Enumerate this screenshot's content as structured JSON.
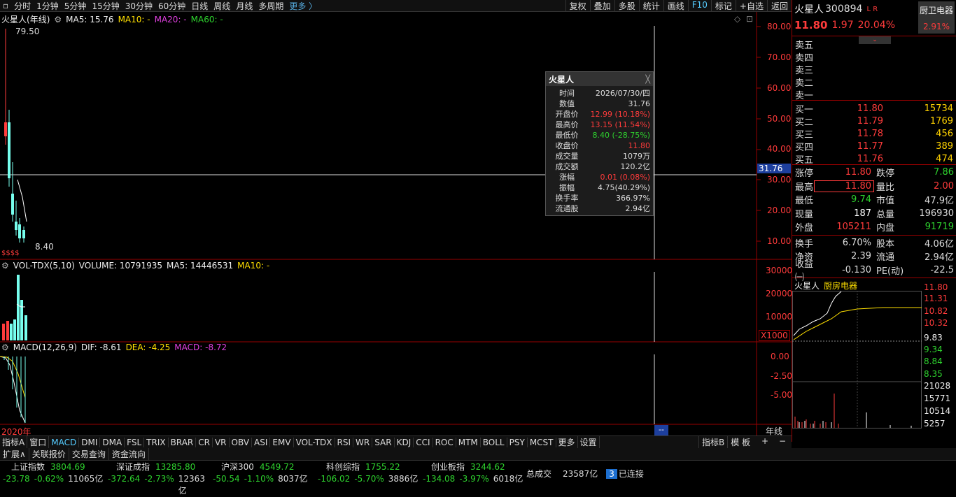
{
  "topbar": {
    "left": [
      "分时",
      "1分钟",
      "5分钟",
      "15分钟",
      "30分钟",
      "60分钟",
      "日线",
      "周线",
      "月线",
      "多周期"
    ],
    "more": "更多 〉",
    "right": [
      "复权",
      "叠加",
      "多股",
      "统计",
      "画线",
      "F10",
      "标记",
      "+自选",
      "返回"
    ]
  },
  "kline_header": {
    "name": "火星人",
    "period": "(年线)",
    "ma5": "MA5: 15.76",
    "ma10": "MA10: -",
    "ma20": "MA20: -",
    "ma60": "MA60: -",
    "high_mark": "79.50",
    "low_mark": "8.40",
    "cross_value": "31.76",
    "sss": "$$$$"
  },
  "price_axis": [
    "80.00",
    "70.00",
    "60.00",
    "50.00",
    "40.00",
    "30.00",
    "20.00",
    "10.00"
  ],
  "vol_header": {
    "name": "VOL-TDX(5,10)",
    "volume": "VOLUME: 10791935",
    "ma5": "MA5: 14446531",
    "ma10": "MA10: -"
  },
  "vol_axis": [
    "30000",
    "20000",
    "10000"
  ],
  "vol_unit": "X1000",
  "macd_header": {
    "name": "MACD(12,26,9)",
    "dif": "DIF: -8.61",
    "dea": "DEA: -4.25",
    "macd": "MACD: -8.72"
  },
  "macd_axis": [
    "0.00",
    "-2.50",
    "-5.00"
  ],
  "year_label": "2020年",
  "period_label": "年线",
  "dashes": "--",
  "tooltip": {
    "title": "火星人",
    "close": "╳",
    "rows": [
      {
        "k": "时间",
        "v": "2026/07/30/四",
        "c": "#ddd"
      },
      {
        "k": "数值",
        "v": "31.76",
        "c": "#ddd"
      },
      {
        "k": "开盘价",
        "v": "12.99 (10.18%)",
        "c": "#ff3b3b"
      },
      {
        "k": "最高价",
        "v": "13.15 (11.54%)",
        "c": "#ff3b3b"
      },
      {
        "k": "最低价",
        "v": "8.40 (-28.75%)",
        "c": "#2ed32e"
      },
      {
        "k": "收盘价",
        "v": "11.80",
        "c": "#ff3b3b"
      },
      {
        "k": "成交量",
        "v": "1079万",
        "c": "#ddd"
      },
      {
        "k": "成交额",
        "v": "120.2亿",
        "c": "#ddd"
      },
      {
        "k": "涨幅",
        "v": "0.01 (0.08%)",
        "c": "#ff3b3b"
      },
      {
        "k": "振幅",
        "v": "4.75(40.29%)",
        "c": "#ddd"
      },
      {
        "k": "换手率",
        "v": "366.97%",
        "c": "#ddd"
      },
      {
        "k": "流通股",
        "v": "2.94亿",
        "c": "#ddd"
      }
    ]
  },
  "quote": {
    "name": "火星人",
    "code": "300894",
    "tags": "L R",
    "sector": "厨卫电器",
    "sector_pct": "2.91%",
    "price": "11.80",
    "change": "1.97",
    "pct": "20.04%"
  },
  "asks": [
    {
      "l": "卖五"
    },
    {
      "l": "卖四"
    },
    {
      "l": "卖三"
    },
    {
      "l": "卖二"
    },
    {
      "l": "卖一"
    }
  ],
  "bids": [
    {
      "l": "买一",
      "p": "11.80",
      "v": "15734"
    },
    {
      "l": "买二",
      "p": "11.79",
      "v": "1769"
    },
    {
      "l": "买三",
      "p": "11.78",
      "v": "456"
    },
    {
      "l": "买四",
      "p": "11.77",
      "v": "389"
    },
    {
      "l": "买五",
      "p": "11.76",
      "v": "474"
    }
  ],
  "stats": [
    {
      "k": "涨停",
      "v": "11.80",
      "vc": "#ff3b3b",
      "k2": "跌停",
      "v2": "7.86",
      "v2c": "#2ed32e"
    },
    {
      "k": "最高",
      "v": "11.80",
      "vc": "#ff3b3b",
      "k2": "量比",
      "v2": "2.00",
      "v2c": "#ff3b3b"
    },
    {
      "k": "最低",
      "v": "9.74",
      "vc": "#2ed32e",
      "k2": "市值",
      "v2": "47.9亿",
      "v2c": "#ddd"
    },
    {
      "k": "现量",
      "v": "187",
      "vc": "#fff",
      "k2": "总量",
      "v2": "196930",
      "v2c": "#ddd"
    },
    {
      "k": "外盘",
      "v": "105211",
      "vc": "#ff3b3b",
      "k2": "内盘",
      "v2": "91719",
      "v2c": "#2ed32e"
    }
  ],
  "stats2": [
    {
      "k": "换手",
      "v": "6.70%",
      "vc": "#ddd",
      "k2": "股本",
      "v2": "4.06亿",
      "v2c": "#ddd"
    },
    {
      "k": "净资",
      "v": "2.39",
      "vc": "#ddd",
      "k2": "流通",
      "v2": "2.94亿",
      "v2c": "#ddd"
    },
    {
      "k": "收益㈠",
      "v": "-0.130",
      "vc": "#ddd",
      "k2": "PE(动)",
      "v2": "-22.5",
      "v2c": "#ddd"
    }
  ],
  "mini": {
    "name": "火星人",
    "sector": "厨房电器",
    "axis_red": [
      "11.80",
      "11.31",
      "10.82",
      "10.32"
    ],
    "mid": "9.83",
    "axis_green": [
      "9.34",
      "8.84",
      "8.35"
    ],
    "vol_axis": [
      "21028",
      "15771",
      "10514",
      "5257"
    ]
  },
  "bottom_tabs": [
    "指标A",
    "窗口",
    "MACD",
    "DMI",
    "DMA",
    "FSL",
    "TRIX",
    "BRAR",
    "CR",
    "VR",
    "OBV",
    "ASI",
    "EMV",
    "VOL-TDX",
    "RSI",
    "WR",
    "SAR",
    "KDJ",
    "CCI",
    "ROC",
    "MTM",
    "BOLL",
    "PSY",
    "MCST",
    "更多",
    "设置"
  ],
  "bottom_right": [
    "指标B",
    "模 板"
  ],
  "status_tabs": [
    "扩展∧",
    "关联报价",
    "交易查询",
    "资金流向"
  ],
  "indices": [
    {
      "name": "上证指数",
      "val": "3804.69",
      "chg": "-23.78",
      "pct": "-0.62%",
      "amt": "11065亿"
    },
    {
      "name": "深证成指",
      "val": "13285.80",
      "chg": "-372.64",
      "pct": "-2.73%",
      "amt": "12363亿"
    },
    {
      "name": "沪深300",
      "val": "4549.72",
      "chg": "-50.54",
      "pct": "-1.10%",
      "amt": "8037亿"
    },
    {
      "name": "科创综指",
      "val": "1755.22",
      "chg": "-106.02",
      "pct": "-5.70%",
      "amt": "3886亿"
    },
    {
      "name": "创业板指",
      "val": "3244.62",
      "chg": "-134.08",
      "pct": "-3.97%",
      "amt": "6018亿"
    }
  ],
  "total": {
    "label": "总成交",
    "val": "23587亿",
    "conn_num": "3",
    "conn": "已连接"
  },
  "colors": {
    "up": "#ff3b3b",
    "down": "#2ed32e",
    "accent": "#5cf",
    "frame": "#990000"
  }
}
